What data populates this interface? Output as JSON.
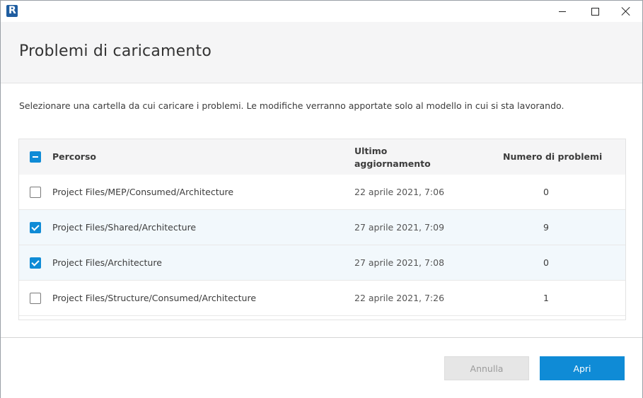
{
  "window": {
    "app_icon_letter": "R"
  },
  "header": {
    "title": "Problemi di caricamento"
  },
  "description": "Selezionare una cartella da cui caricare i problemi. Le modifiche verranno apportate solo al modello in cui si sta lavorando.",
  "table": {
    "columns": {
      "path": "Percorso",
      "updated_line1": "Ultimo",
      "updated_line2": "aggiornamento",
      "count": "Numero di problemi"
    },
    "select_all_state": "partial",
    "rows": [
      {
        "path": "Project Files/MEP/Consumed/Architecture",
        "updated": "22 aprile 2021, 7:06",
        "count": "0",
        "checked": false
      },
      {
        "path": "Project Files/Shared/Architecture",
        "updated": "27 aprile 2021, 7:09",
        "count": "9",
        "checked": true
      },
      {
        "path": "Project Files/Architecture",
        "updated": "27 aprile 2021, 7:08",
        "count": "0",
        "checked": true
      },
      {
        "path": "Project Files/Structure/Consumed/Architecture",
        "updated": "22 aprile 2021, 7:26",
        "count": "1",
        "checked": false
      }
    ]
  },
  "footer": {
    "cancel_label": "Annulla",
    "open_label": "Apri"
  },
  "colors": {
    "accent": "#0f8bd6",
    "selected_row": "#f2f8fc",
    "header_bg": "#f5f5f6"
  }
}
